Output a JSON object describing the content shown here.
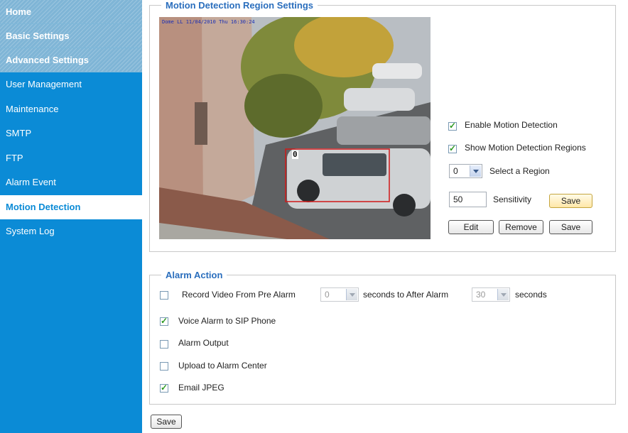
{
  "sidebar": {
    "sections": [
      "Home",
      "Basic Settings",
      "Advanced Settings"
    ],
    "items": [
      "User Management",
      "Maintenance",
      "SMTP",
      "FTP",
      "Alarm Event",
      "Motion Detection",
      "System Log"
    ],
    "active_item": "Motion Detection"
  },
  "motion": {
    "legend": "Motion Detection Region Settings",
    "camera_timestamp": "Dome LL  11/04/2010 Thu 16:30:24",
    "region_label": "0",
    "enable_label": "Enable Motion Detection",
    "enable_checked": true,
    "show_regions_label": "Show Motion Detection Regions",
    "show_regions_checked": true,
    "region_value": "0",
    "select_region_label": "Select a Region",
    "sensitivity_value": "50",
    "sensitivity_label": "Sensitivity",
    "save_label": "Save",
    "edit_label": "Edit",
    "remove_label": "Remove",
    "save2_label": "Save"
  },
  "alarm": {
    "legend": "Alarm Action",
    "record_label": "Record Video From Pre Alarm",
    "record_checked": false,
    "pre_alarm_value": "0",
    "seconds_to_label": "seconds  to After Alarm",
    "after_alarm_value": "30",
    "seconds_label": "seconds",
    "voice_label": "Voice Alarm to SIP Phone",
    "voice_checked": true,
    "output_label": "Alarm Output",
    "output_checked": false,
    "upload_label": "Upload to Alarm Center",
    "upload_checked": false,
    "email_label": "Email JPEG",
    "email_checked": true
  },
  "footer": {
    "save_label": "Save"
  }
}
